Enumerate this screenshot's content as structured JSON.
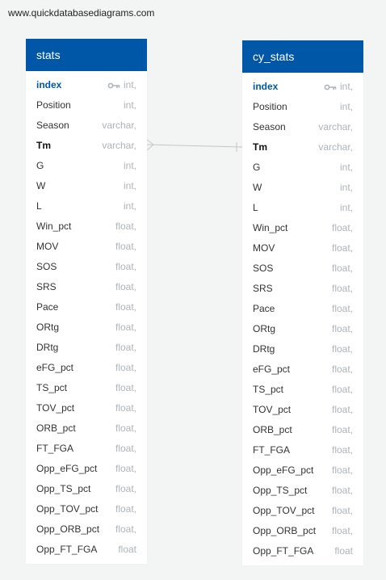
{
  "watermark": "www.quickdatabasediagrams.com",
  "tables": {
    "stats": {
      "name": "stats",
      "fields": [
        {
          "name": "index",
          "type": "int,"
        },
        {
          "name": "Position",
          "type": "int,"
        },
        {
          "name": "Season",
          "type": "varchar,"
        },
        {
          "name": "Tm",
          "type": "varchar,"
        },
        {
          "name": "G",
          "type": "int,"
        },
        {
          "name": "W",
          "type": "int,"
        },
        {
          "name": "L",
          "type": "int,"
        },
        {
          "name": "Win_pct",
          "type": "float,"
        },
        {
          "name": "MOV",
          "type": "float,"
        },
        {
          "name": "SOS",
          "type": "float,"
        },
        {
          "name": "SRS",
          "type": "float,"
        },
        {
          "name": "Pace",
          "type": "float,"
        },
        {
          "name": "ORtg",
          "type": "float,"
        },
        {
          "name": "DRtg",
          "type": "float,"
        },
        {
          "name": "eFG_pct",
          "type": "float,"
        },
        {
          "name": "TS_pct",
          "type": "float,"
        },
        {
          "name": "TOV_pct",
          "type": "float,"
        },
        {
          "name": "ORB_pct",
          "type": "float,"
        },
        {
          "name": "FT_FGA",
          "type": "float,"
        },
        {
          "name": "Opp_eFG_pct",
          "type": "float,"
        },
        {
          "name": "Opp_TS_pct",
          "type": "float,"
        },
        {
          "name": "Opp_TOV_pct",
          "type": "float,"
        },
        {
          "name": "Opp_ORB_pct",
          "type": "float,"
        },
        {
          "name": "Opp_FT_FGA",
          "type": "float"
        }
      ]
    },
    "cy_stats": {
      "name": "cy_stats",
      "fields": [
        {
          "name": "index",
          "type": "int,"
        },
        {
          "name": "Position",
          "type": "int,"
        },
        {
          "name": "Season",
          "type": "varchar,"
        },
        {
          "name": "Tm",
          "type": "varchar,"
        },
        {
          "name": "G",
          "type": "int,"
        },
        {
          "name": "W",
          "type": "int,"
        },
        {
          "name": "L",
          "type": "int,"
        },
        {
          "name": "Win_pct",
          "type": "float,"
        },
        {
          "name": "MOV",
          "type": "float,"
        },
        {
          "name": "SOS",
          "type": "float,"
        },
        {
          "name": "SRS",
          "type": "float,"
        },
        {
          "name": "Pace",
          "type": "float,"
        },
        {
          "name": "ORtg",
          "type": "float,"
        },
        {
          "name": "DRtg",
          "type": "float,"
        },
        {
          "name": "eFG_pct",
          "type": "float,"
        },
        {
          "name": "TS_pct",
          "type": "float,"
        },
        {
          "name": "TOV_pct",
          "type": "float,"
        },
        {
          "name": "ORB_pct",
          "type": "float,"
        },
        {
          "name": "FT_FGA",
          "type": "float,"
        },
        {
          "name": "Opp_eFG_pct",
          "type": "float,"
        },
        {
          "name": "Opp_TS_pct",
          "type": "float,"
        },
        {
          "name": "Opp_TOV_pct",
          "type": "float,"
        },
        {
          "name": "Opp_ORB_pct",
          "type": "float,"
        },
        {
          "name": "Opp_FT_FGA",
          "type": "float"
        }
      ]
    }
  },
  "relationship": {
    "from": "stats.Tm",
    "to": "cy_stats.Tm",
    "from_end": "crow-foot-many",
    "to_end": "bar-one"
  },
  "colors": {
    "header": "#0057a8",
    "primary_key": "#0057a8",
    "type_text": "#aeb4b9",
    "background": "#f3f5f4",
    "line": "#c2c6c9"
  },
  "icons": {
    "primary_key": "key-icon"
  }
}
